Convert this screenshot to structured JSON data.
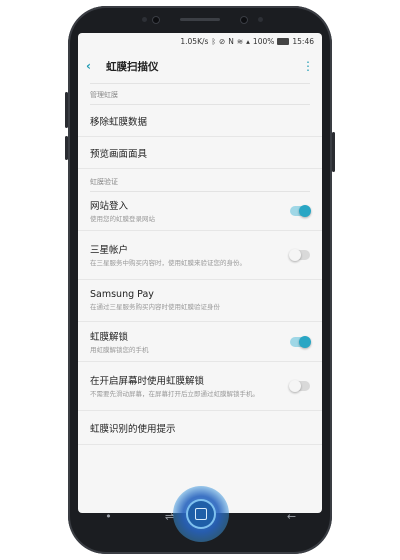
{
  "status_bar": {
    "speed": "1.05K/s",
    "icons": [
      "bluetooth-icon",
      "mute-icon",
      "nfc-icon",
      "wifi-icon",
      "signal-icon"
    ],
    "battery": "100%",
    "time": "15:46"
  },
  "app_bar": {
    "title": "虹膜扫描仪",
    "back_icon": "‹",
    "more_icon": "⋮"
  },
  "sections": {
    "manage": {
      "title": "管理虹膜",
      "items": [
        {
          "title": "移除虹膜数据"
        },
        {
          "title": "预览画面面具"
        }
      ]
    },
    "verify": {
      "title": "虹膜验证",
      "items": [
        {
          "title": "网站登入",
          "subtitle": "使用您的虹膜登录网站",
          "toggle": true
        },
        {
          "title": "三星帐户",
          "subtitle": "在三星服务中购买内容时，使用虹膜来验证您的身份。",
          "toggle": false
        },
        {
          "title": "Samsung Pay",
          "subtitle": "在通过三星服务购买内容时使用虹膜验证身份"
        },
        {
          "title": "虹膜解锁",
          "subtitle": "用虹膜解锁您的手机",
          "toggle": true
        },
        {
          "title": "在开启屏幕时使用虹膜解锁",
          "subtitle": "不需要先滑动屏幕，在屏幕打开后立即通过虹膜解锁手机。",
          "toggle": false
        },
        {
          "title": "虹膜识别的使用提示"
        }
      ]
    }
  },
  "nav_bar": {
    "dot": "•",
    "recent": "⇌",
    "home": "□",
    "back": "←"
  },
  "colors": {
    "accent": "#29a6c4",
    "toggle_on_track": "#9fd7e6",
    "toggle_off_track": "#d9d9d9"
  }
}
